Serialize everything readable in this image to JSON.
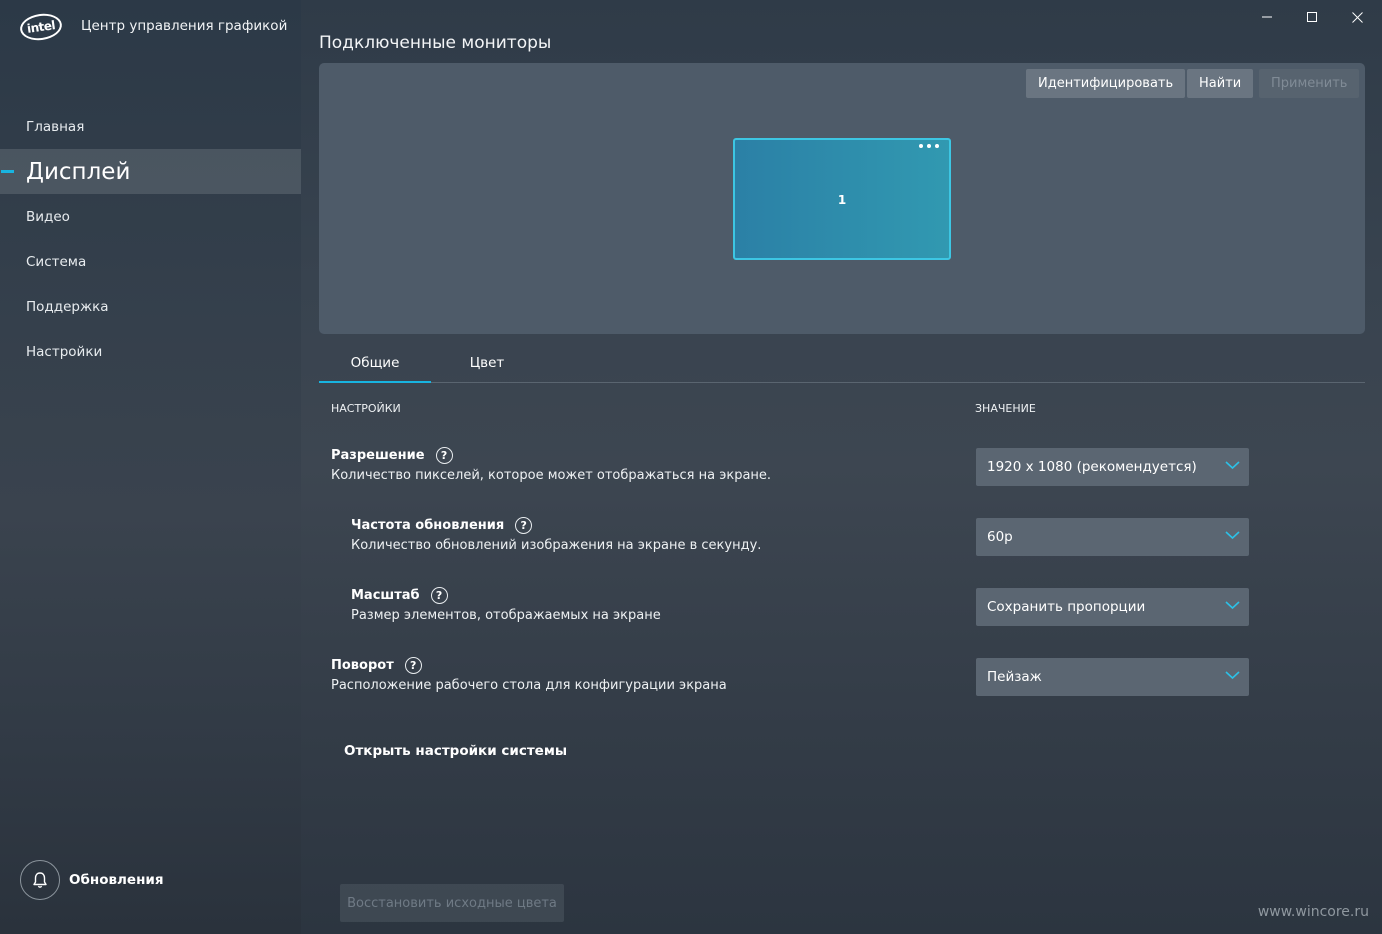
{
  "app": {
    "logo_text": "intel",
    "title": "Центр управления графикой"
  },
  "window_controls": {
    "minimize_icon": "minimize-icon",
    "maximize_icon": "maximize-icon",
    "close_icon": "close-icon"
  },
  "sidebar": {
    "items": [
      {
        "label": "Главная",
        "active": false
      },
      {
        "label": "Дисплей",
        "active": true
      },
      {
        "label": "Видео",
        "active": false
      },
      {
        "label": "Система",
        "active": false
      },
      {
        "label": "Поддержка",
        "active": false
      },
      {
        "label": "Настройки",
        "active": false
      }
    ],
    "updates_label": "Обновления",
    "accent_color": "#18b4e0"
  },
  "monitors": {
    "title": "Подключенные мониторы",
    "identify_label": "Идентифицировать",
    "find_label": "Найти",
    "apply_label": "Применить",
    "monitor_number": "1"
  },
  "tabs": [
    {
      "label": "Общие",
      "active": true
    },
    {
      "label": "Цвет",
      "active": false
    }
  ],
  "columns": {
    "settings": "НАСТРОЙКИ",
    "value": "ЗНАЧЕНИЕ"
  },
  "settings": [
    {
      "title": "Разрешение",
      "description": "Количество пикселей, которое может отображаться на экране.",
      "value": "1920 x 1080 (рекомендуется)"
    },
    {
      "title": "Частота обновления",
      "description": "Количество обновлений изображения на экране в секунду.",
      "value": "60p"
    },
    {
      "title": "Масштаб",
      "description": "Размер элементов, отображаемых на экране",
      "value": "Сохранить пропорции"
    },
    {
      "title": "Поворот",
      "description": "Расположение рабочего стола для конфигурации экрана",
      "value": "Пейзаж"
    }
  ],
  "help_glyph": "?",
  "open_system_settings": "Открыть настройки системы",
  "restore_colors": "Восстановить исходные цвета",
  "watermark": "www.wincore.ru"
}
